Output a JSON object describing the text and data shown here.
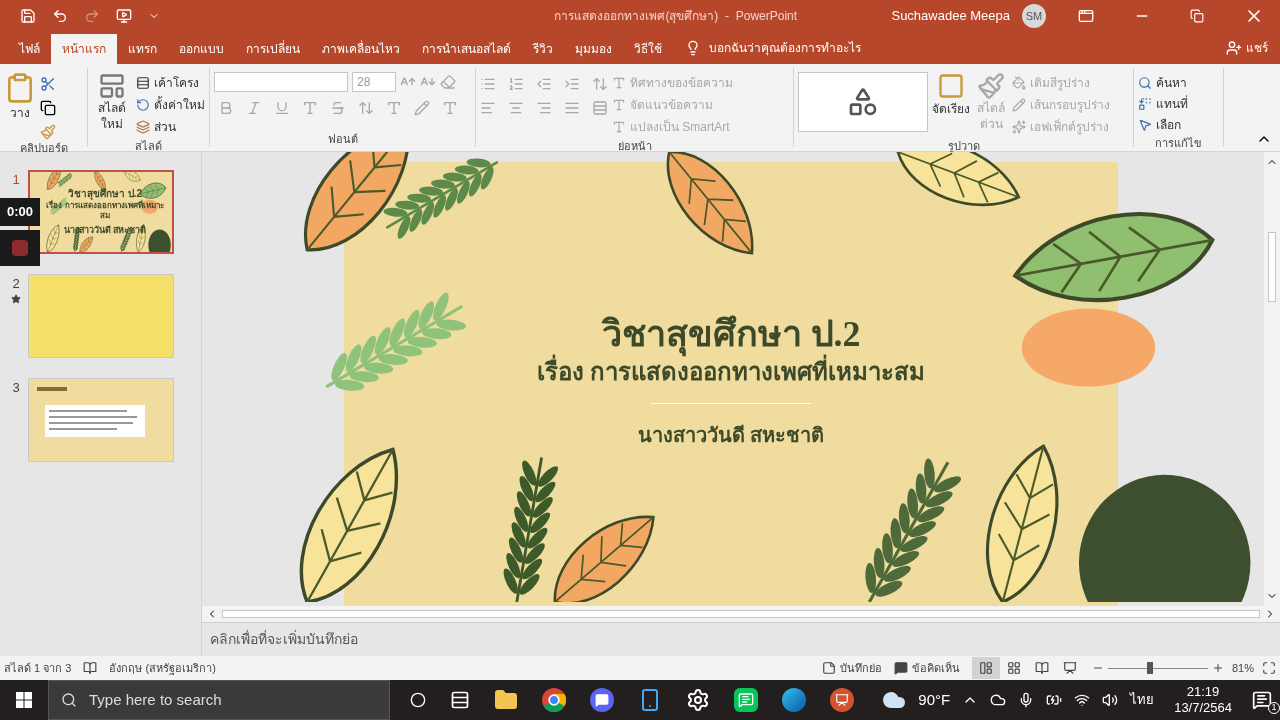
{
  "window": {
    "title": "การแสดงออกทางเพศ(สุขศึกษา)  -  PowerPoint",
    "user": "Suchawadee Meepa",
    "initials": "SM"
  },
  "tabs": [
    {
      "label": "ไฟล์",
      "selected": false
    },
    {
      "label": "หน้าแรก",
      "selected": true
    },
    {
      "label": "แทรก",
      "selected": false
    },
    {
      "label": "ออกแบบ",
      "selected": false
    },
    {
      "label": "การเปลี่ยน",
      "selected": false
    },
    {
      "label": "ภาพเคลื่อนไหว",
      "selected": false
    },
    {
      "label": "การนำเสนอสไลด์",
      "selected": false
    },
    {
      "label": "รีวิว",
      "selected": false
    },
    {
      "label": "มุมมอง",
      "selected": false
    },
    {
      "label": "วิธีใช้",
      "selected": false
    }
  ],
  "tell_me": "บอกฉันว่าคุณต้องการทำอะไร",
  "share": "แชร์",
  "ribbon": {
    "clipboard": {
      "label": "คลิปบอร์ด",
      "paste": "วาง"
    },
    "slides": {
      "label": "สไลด์",
      "new_slide": "สไลด์ ใหม่",
      "commands": [
        {
          "label": "เค้าโครง",
          "disabled": false
        },
        {
          "label": "ตั้งค่าใหม่",
          "disabled": false
        },
        {
          "label": "ส่วน",
          "disabled": false
        }
      ]
    },
    "font": {
      "label": "ฟอนต์",
      "size": "28"
    },
    "paragraph": {
      "label": "ย่อหน้า",
      "commands": [
        {
          "label": "ทิศทางของข้อความ",
          "disabled": true
        },
        {
          "label": "จัดแนวข้อความ",
          "disabled": true
        },
        {
          "label": "แปลงเป็น SmartArt",
          "disabled": true
        }
      ]
    },
    "drawing": {
      "label": "รูปวาด",
      "arrange": "จัดเรียง",
      "quick_styles": "สไตล์ ด่วน",
      "commands": [
        {
          "label": "เติมสีรูปร่าง",
          "disabled": true
        },
        {
          "label": "เส้นกรอบรูปร่าง",
          "disabled": true
        },
        {
          "label": "เอฟเฟ็กต์รูปร่าง",
          "disabled": true
        }
      ]
    },
    "editing": {
      "label": "การแก้ไข",
      "commands": [
        {
          "label": "ค้นหา",
          "kind": "find"
        },
        {
          "label": "แทนที่",
          "kind": "replace"
        },
        {
          "label": "เลือก",
          "kind": "select"
        }
      ]
    }
  },
  "thumbnails": [
    {
      "number": "1",
      "selected": true,
      "animated": false,
      "kind": "title",
      "title": "วิชาสุขศึกษา ป.2",
      "subtitle": "เรื่อง การแสดงออกทางเพศที่เหมาะสม",
      "author": "นางสาววันดี สหะชาติ"
    },
    {
      "number": "2",
      "selected": false,
      "animated": true,
      "kind": "blank"
    },
    {
      "number": "3",
      "selected": false,
      "animated": false,
      "kind": "content"
    }
  ],
  "recording": {
    "time": "0:00"
  },
  "slide": {
    "title": "วิชาสุขศึกษา ป.2",
    "subtitle": "เรื่อง การแสดงออกทางเพศที่เหมาะสม",
    "author": "นางสาววันดี สหะชาติ"
  },
  "notes": {
    "placeholder": "คลิกเพื่อที่จะเพิ่มบันทึกย่อ"
  },
  "status_bar": {
    "slide": "สไลด์ 1 จาก 3",
    "language": "อังกฤษ (สหรัฐอเมริกา)",
    "notes": "บันทึกย่อ",
    "comments": "ข้อคิดเห็น",
    "views": [
      {
        "kind": "normal",
        "selected": true
      },
      {
        "kind": "sorter",
        "selected": false
      },
      {
        "kind": "reading",
        "selected": false
      },
      {
        "kind": "show",
        "selected": false
      }
    ],
    "zoom": {
      "level": 0.42,
      "reading": "81%"
    }
  },
  "taskbar": {
    "search": {
      "placeholder": "Type here to search"
    },
    "weather": "90°F",
    "language": "ไทย",
    "time": "21:19",
    "date": "13/7/2564",
    "notifications": "1"
  }
}
